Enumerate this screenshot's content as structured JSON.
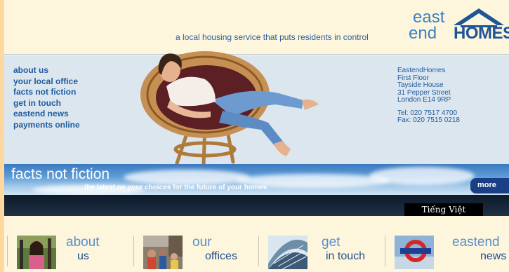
{
  "header": {
    "tagline": "a local housing service that puts residents in control",
    "logo": {
      "line1": "east",
      "line2a": "end",
      "line2b": "HOMES"
    }
  },
  "nav": {
    "items": [
      "about us",
      "your local office",
      "facts not fiction",
      "get in touch",
      "eastend news",
      "payments online"
    ]
  },
  "address": {
    "lines": [
      "EastendHomes",
      "First Floor",
      "Tayside House",
      "31 Pepper Street",
      "London E14 9RP"
    ],
    "tel": "Tel:  020 7517 4700",
    "fax": "Fax: 020 7515 0218"
  },
  "banner": {
    "title": "facts not fiction",
    "subtitle": "the latest on your choices for the future of your homes",
    "more": "more"
  },
  "language": {
    "label": "Tiếng Việt"
  },
  "tiles": [
    {
      "line1": "about",
      "line2": "us",
      "image": "playground-photo"
    },
    {
      "line1": "our",
      "line2": "offices",
      "image": "street-market-photo"
    },
    {
      "line1": "get",
      "line2": "in touch",
      "image": "glass-roof-photo"
    },
    {
      "line1": "eastend",
      "line2": "news",
      "image": "underground-sign-photo"
    }
  ],
  "colors": {
    "page_bg": "#fdf6dd",
    "band_bg": "#dce6ef",
    "link": "#1f5c9e",
    "logo_blue": "#3d80c4",
    "more_button": "#1a3f86",
    "frame_orange": "#ffd8a0"
  }
}
